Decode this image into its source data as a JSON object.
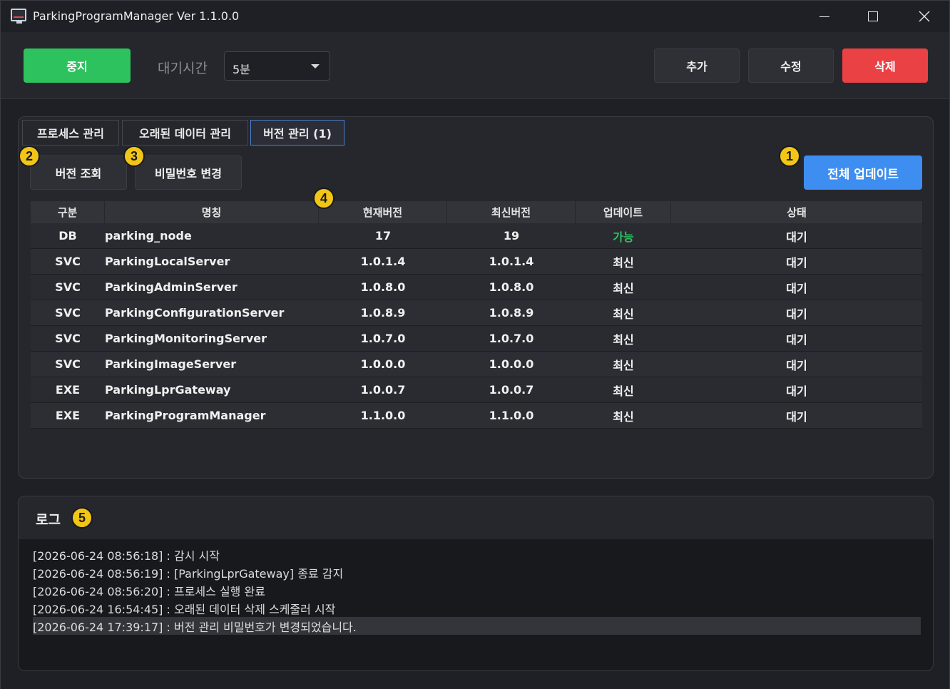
{
  "window": {
    "title": "ParkingProgramManager Ver 1.1.0.0"
  },
  "toolbar": {
    "stop_label": "중지",
    "wait_label": "대기시간",
    "wait_value": "5분",
    "add_label": "추가",
    "edit_label": "수정",
    "delete_label": "삭제"
  },
  "tabs": [
    {
      "label": "프로세스 관리"
    },
    {
      "label": "오래된 데이터 관리"
    },
    {
      "label": "버전 관리 (1)"
    }
  ],
  "version": {
    "query_label": "버전 조회",
    "password_label": "비밀번호 변경",
    "update_all_label": "전체 업데이트",
    "columns": [
      "구분",
      "명칭",
      "현재버전",
      "최신버전",
      "업데이트",
      "상태"
    ],
    "rows": [
      {
        "type": "DB",
        "name": "parking_node",
        "current": "17",
        "latest": "19",
        "update": "가능",
        "status": "대기"
      },
      {
        "type": "SVC",
        "name": "ParkingLocalServer",
        "current": "1.0.1.4",
        "latest": "1.0.1.4",
        "update": "최신",
        "status": "대기"
      },
      {
        "type": "SVC",
        "name": "ParkingAdminServer",
        "current": "1.0.8.0",
        "latest": "1.0.8.0",
        "update": "최신",
        "status": "대기"
      },
      {
        "type": "SVC",
        "name": "ParkingConfigurationServer",
        "current": "1.0.8.9",
        "latest": "1.0.8.9",
        "update": "최신",
        "status": "대기"
      },
      {
        "type": "SVC",
        "name": "ParkingMonitoringServer",
        "current": "1.0.7.0",
        "latest": "1.0.7.0",
        "update": "최신",
        "status": "대기"
      },
      {
        "type": "SVC",
        "name": "ParkingImageServer",
        "current": "1.0.0.0",
        "latest": "1.0.0.0",
        "update": "최신",
        "status": "대기"
      },
      {
        "type": "EXE",
        "name": "ParkingLprGateway",
        "current": "1.0.0.7",
        "latest": "1.0.0.7",
        "update": "최신",
        "status": "대기"
      },
      {
        "type": "EXE",
        "name": "ParkingProgramManager",
        "current": "1.1.0.0",
        "latest": "1.1.0.0",
        "update": "최신",
        "status": "대기"
      }
    ]
  },
  "badges": [
    "1",
    "2",
    "3",
    "4",
    "5"
  ],
  "log": {
    "title": "로그",
    "lines": [
      "[2026-06-24 08:56:18] : 감시 시작",
      "[2026-06-24 08:56:19] : [ParkingLprGateway] 종료 감지",
      "[2026-06-24 08:56:20] : 프로세스 실행 완료",
      "[2026-06-24 16:54:45] : 오래된 데이터 삭제 스케줄러 시작",
      "[2026-06-24 17:39:17] : 버전 관리 비밀번호가 변경되었습니다."
    ]
  },
  "colors": {
    "stop": "#2ec25e",
    "delete": "#ea4145",
    "update_all": "#3d8ef0",
    "available": "#2ec25e",
    "badge": "#f2c617"
  }
}
